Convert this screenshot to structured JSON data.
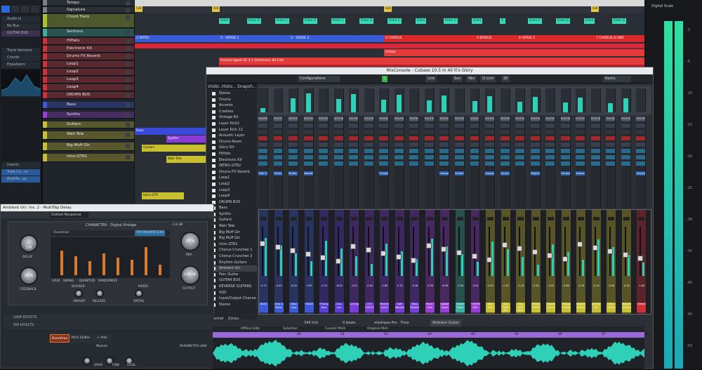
{
  "tracks": [
    {
      "name": "Tempo",
      "color": "#7a7f87"
    },
    {
      "name": "Signature",
      "color": "#7a7f87"
    },
    {
      "name": "Chord Track",
      "color": "#a8c030"
    },
    {
      "name": "Sections",
      "color": "#3ab0a0"
    },
    {
      "name": "HiHats",
      "color": "#d0303a"
    },
    {
      "name": "Electronic Kit",
      "color": "#d0303a"
    },
    {
      "name": "Drums FX Reverb",
      "color": "#d0303a"
    },
    {
      "name": "Loop1",
      "color": "#d0303a"
    },
    {
      "name": "Loop2",
      "color": "#d0303a"
    },
    {
      "name": "Loop3",
      "color": "#d0303a"
    },
    {
      "name": "Loop4",
      "color": "#d0303a"
    },
    {
      "name": "DRUMS BUS",
      "color": "#d0303a"
    },
    {
      "name": "Bass",
      "color": "#3d5ad8"
    },
    {
      "name": "Synths",
      "color": "#9a3dd8"
    },
    {
      "name": "Guitars",
      "color": "#c8c030"
    },
    {
      "name": "Wah Tele",
      "color": "#c8c030"
    },
    {
      "name": "Big Muff Gtr",
      "color": "#c8c030"
    },
    {
      "name": "Intro GTR1",
      "color": "#c8c030"
    }
  ],
  "loop1_sub": "(Loop1)",
  "inspector": {
    "audio_in": "Audio In",
    "no_bus": "No Bus",
    "guitar_bus": "GUITAR BUS",
    "track_versions": "Track Versions",
    "chords": "Chords",
    "equalizers": "Equalizers",
    "inserts": "Inserts",
    "sends": "Sends",
    "insert1": "Tube Co...ar",
    "insert2": "MultiTa...ay"
  },
  "markers": {
    "intro": "1 INTRO",
    "verse1": "2 - VERSE 1",
    "verse2": "3 - VERSE 2",
    "chorus": "4 CHORUS",
    "bridge": "5 BRIDGE",
    "verse3": "6 VERSE 2",
    "chorus2": "7 CHORUS & END"
  },
  "chords": [
    "Emin",
    "Emin G",
    "Emin C",
    "Emin G",
    "Emin C",
    "Emin G",
    "Emin C",
    "Emin",
    "Emin C",
    "Emin",
    "G",
    "Emin C",
    "Emin G",
    "Emin",
    "Emin G"
  ],
  "clip_labels": {
    "groove": "Groove Agent SE 4.1 (Electronic Kit Full)",
    "hihats": "HiHats",
    "bass": "Bass",
    "synths": "Synths",
    "guitars": "Guitars",
    "wah": "Wah Tele",
    "intro": "Intro GTR"
  },
  "mixconsole": {
    "title": "MixConsole - Cubase 10.5 In All It's Glory",
    "config": "Configurations",
    "link": "Link",
    "sus": "Sus",
    "abs": "Abs",
    "qlink": "Q-Link",
    "num": "26",
    "racks": "Racks",
    "tabs": [
      "Visibi...",
      "Histo...",
      "Snapsh..."
    ],
    "bottom_tabs": [
      "Channel",
      "Zones"
    ],
    "visibility": [
      "Stereo",
      "Drums",
      "Accents",
      "Crashes",
      "Vintage Kit",
      "Layer Kick1",
      "Layer Kick 12",
      "Acoustic Layer",
      "Drums Room",
      "Glory Kit",
      "HiHats",
      "Electronic Kit",
      "INTRO-GTR2",
      "Drums FX Reverb",
      "Loop1",
      "Loop2",
      "Loop3",
      "Loop4",
      "DRUMS BUS",
      "Bass",
      "Synths",
      "Guitars",
      "Wah Tele",
      "Big Muff Gtr",
      "Big Muff Gtr",
      "Intro GTR1",
      "Chorus Crunches 1",
      "Chorus Crunches 2",
      "Rhythm Guitars",
      "Ambient Gtr",
      "Perc Guitar",
      "GUITAR BUS",
      "REVERSE GUITARS",
      "VOX",
      "Input/Output Channe",
      "Stereo"
    ],
    "channel_names": [
      "BASS",
      "Amp & Pedal",
      "Bass Amp",
      "+BASS",
      "Pulsing Bass",
      "Club-mid",
      "Lurking",
      "LFO SYNTH",
      "Mayhem Synth",
      "Soft Wavetable",
      "Bass Doubler",
      "Pluck I love",
      "Industrial Synth",
      "Chord Track",
      "SYNTHS BUS",
      "Wah Tele",
      "Big Muff Gtr",
      "Big Muff Gtr2",
      "INTRO GTR2",
      "Chorus Crunches",
      "Chorus Crunches",
      "Rhythm Guitars",
      "Ambient Gtr",
      "Perc Guitar",
      "Reverse Guitars",
      "Stereo"
    ],
    "channel_colors": [
      "#3d5ad8",
      "#3d5ad8",
      "#3d5ad8",
      "#3d5ad8",
      "#5b3dd8",
      "#5b3dd8",
      "#7a3dd8",
      "#7a3dd8",
      "#7a3dd8",
      "#7a3dd8",
      "#7a3dd8",
      "#9a3dd8",
      "#9a3dd8",
      "#3ab0a0",
      "#9a3dd8",
      "#c8c030",
      "#c8c030",
      "#c8c030",
      "#c8c030",
      "#c8c030",
      "#c8c030",
      "#c8c030",
      "#c8c030",
      "#c8c030",
      "#c8c030",
      "#d0303a"
    ],
    "levels": [
      "-0.71",
      "-0.00",
      "-6.42",
      "-3.90",
      "-5.12",
      "-6.02",
      "-0.01",
      "-2.40",
      "-1.80",
      "-5.31",
      "-0.28",
      "-3.00",
      "-6.36",
      "-3.00",
      "-3.42",
      "-0.01",
      "-7.30",
      "-1.20",
      "-2.50",
      "-3.20",
      "-0.80",
      "-4.10",
      "-5.10",
      "-0.00",
      "-0.00",
      "-1.80"
    ],
    "insert_labels": [
      "Tube Co...",
      "Compr...",
      "Studio...",
      "StereoDelay",
      "",
      "",
      "",
      "",
      "Frequency",
      "",
      "",
      "",
      "Compressor",
      "Studio EQ",
      "",
      "Ampeg...",
      "Compr...",
      "",
      "Magneto",
      "",
      "Compressor",
      "Ampeg...",
      "",
      "",
      "",
      "Ampeg..."
    ],
    "routing": "ROUTING"
  },
  "multitap": {
    "title": "Ambient Gtr: Ins. 2 - MultiTap Delay",
    "preset": "Dotted Response",
    "character": "CHARACTER",
    "digital_vintage": "Digital Vintage",
    "overdrive": "Overdrive",
    "on": "On",
    "tap_params": "TAP PARAMETERS",
    "delay": "DELAY",
    "feedback": "FEEDBACK",
    "mix": "MIX",
    "output": "OUTPUT",
    "ducker": "DUCKER",
    "mixer": "MIXER",
    "amount": "AMOUNT",
    "release": "RELEASE",
    "spatial": "SPATIAL",
    "delay_val": "1/8",
    "feedback_val": "25 %",
    "mix_val": "20 %",
    "output_val": "0.00 dB",
    "loop_effects": "LOOP EFFECTS",
    "tap_effects": "TAP EFFECTS",
    "mod": "Pitch Shifter",
    "add": "+ Add Module",
    "param_link": "PARAMETER LINK",
    "drive": "DRIVE",
    "tone": "TONE",
    "level": "LEVEL",
    "grid": "GRID",
    "swing": "SWING",
    "quantize": "QUANTIZE",
    "randomize": "RANDOMIZE",
    "db_val": "-1.8 dB",
    "bars": [
      0.7,
      0.55,
      0.4,
      0.62,
      0.5,
      0.45,
      0.8,
      0.3
    ]
  },
  "editor": {
    "time": "346 tick",
    "zero": "0 beats",
    "mode": "elastique Pro - Time",
    "track": "Ambient Guitar",
    "labels": [
      "Offline Edits",
      "Selection",
      "Current Pitch",
      "Original Pitch"
    ],
    "pos": [
      "40",
      "41",
      "42",
      "43",
      "44",
      "45",
      "46",
      "47",
      "48"
    ]
  },
  "meter": {
    "label": "Digital Scale",
    "scale": [
      "-3",
      "-6",
      "-10",
      "-15",
      "-20",
      "-25",
      "-30",
      "-35",
      "-40",
      "-45",
      "-50"
    ]
  }
}
